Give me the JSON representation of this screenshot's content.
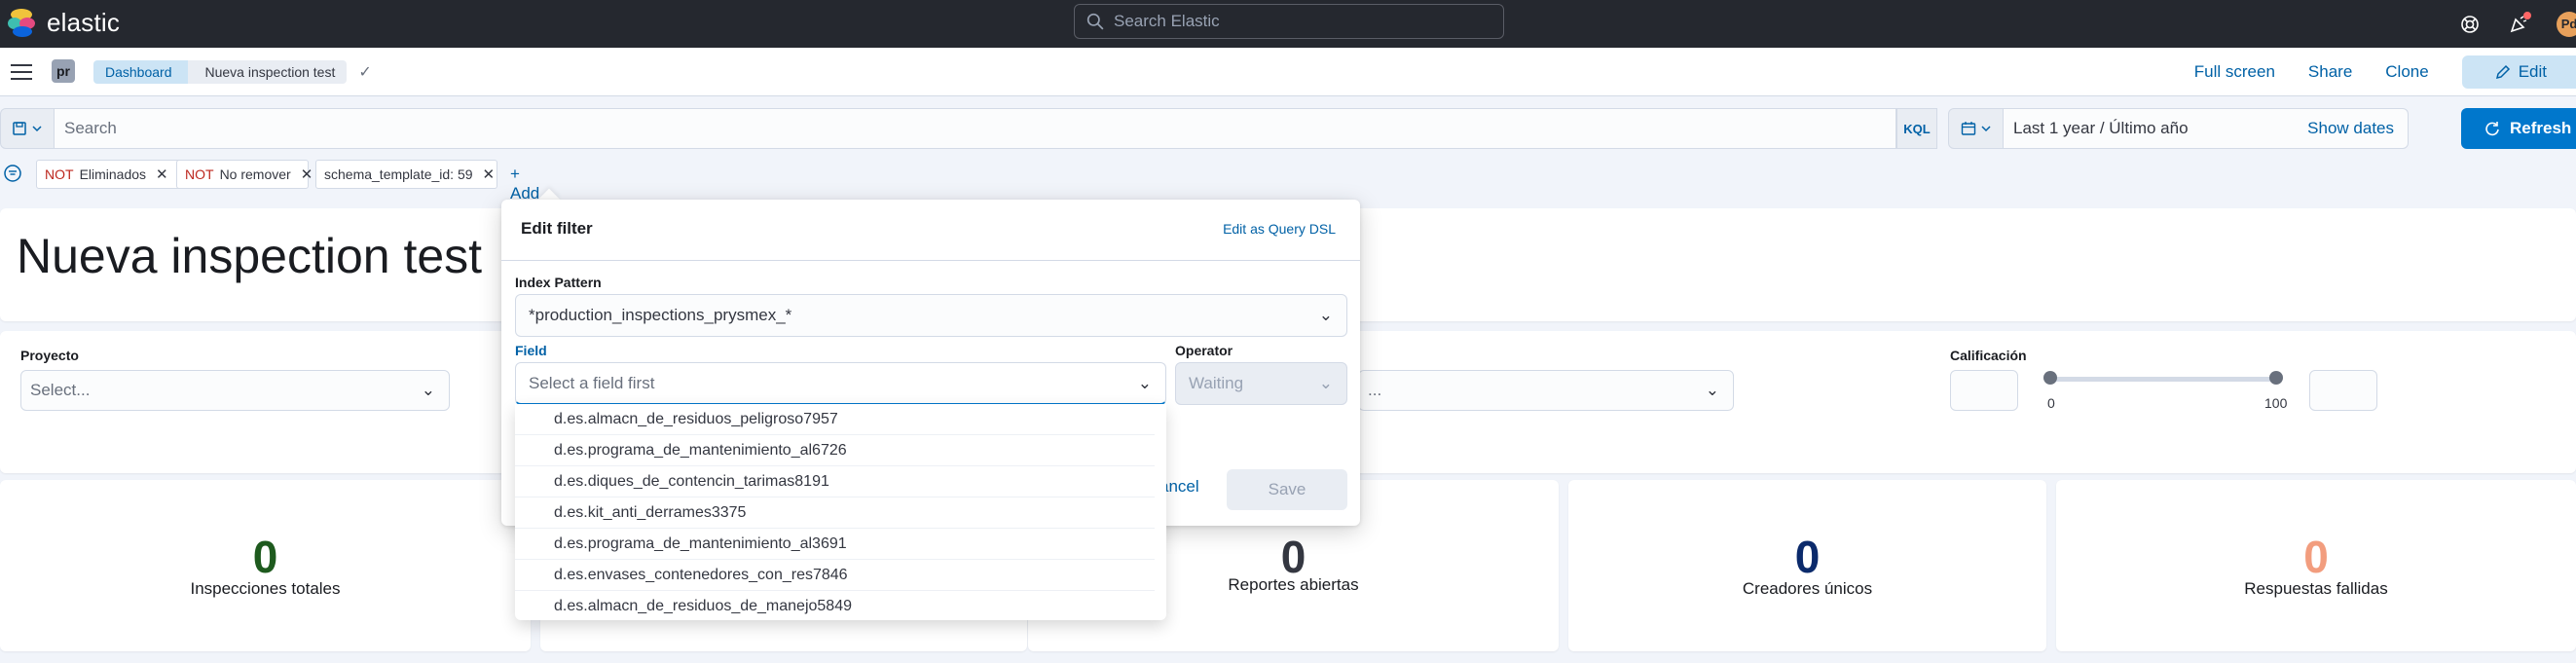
{
  "app": {
    "logo_text": "elastic",
    "global_search_placeholder": "Search Elastic",
    "avatar_initials": "Pd"
  },
  "subbar": {
    "space_badge": "pr",
    "breadcrumbs": [
      "Dashboard",
      "Nueva inspection test"
    ],
    "links": {
      "full_screen": "Full screen",
      "share": "Share",
      "clone": "Clone",
      "edit": "Edit"
    }
  },
  "query": {
    "search_placeholder": "Search",
    "language": "KQL",
    "date_range": "Last 1 year / Último año",
    "show_dates": "Show dates",
    "refresh": "Refresh"
  },
  "filters": [
    {
      "negate": "NOT",
      "label": "Eliminados"
    },
    {
      "negate": "NOT",
      "label": "No remover"
    },
    {
      "negate": "",
      "label": "schema_template_id: 59"
    }
  ],
  "add_filter": "+ Add filter",
  "dashboard": {
    "title": "Nueva inspection test",
    "controls": {
      "proyecto_label": "Proyecto",
      "proyecto_placeholder": "Select...",
      "hidden_select_placeholder": "...",
      "calificacion_label": "Calificación",
      "range_min": "0",
      "range_max": "100"
    },
    "stats": [
      {
        "value": "0",
        "label": "Inspecciones totales",
        "color": "#1e5a1e"
      },
      {
        "value": "0",
        "label": "Reportes abiertas",
        "color": "#343741"
      },
      {
        "value": "0",
        "label": "Creadores únicos",
        "color": "#0b2a6b"
      },
      {
        "value": "0",
        "label": "Respuestas fallidas",
        "color": "#f29d7e"
      }
    ]
  },
  "edit_filter": {
    "title": "Edit filter",
    "edit_dsl": "Edit as Query DSL",
    "index_pattern_label": "Index Pattern",
    "index_pattern_value": "*production_inspections_prysmex_*",
    "field_label": "Field",
    "field_placeholder": "Select a field first",
    "operator_label": "Operator",
    "operator_value": "Waiting",
    "cancel": "ancel",
    "save": "Save",
    "field_options": [
      "d.es.almacn_de_residuos_peligroso7957",
      "d.es.programa_de_mantenimiento_al6726",
      "d.es.diques_de_contencin_tarimas8191",
      "d.es.kit_anti_derrames3375",
      "d.es.programa_de_mantenimiento_al3691",
      "d.es.envases_contenedores_con_res7846",
      "d.es.almacn_de_residuos_de_manejo5849"
    ]
  }
}
